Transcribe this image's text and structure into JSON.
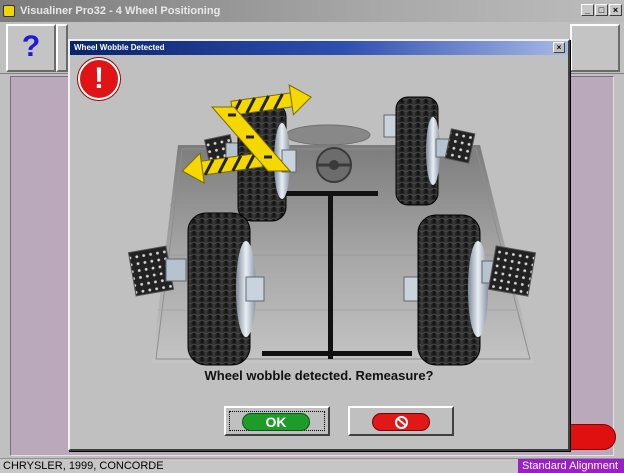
{
  "app": {
    "title": "Visualiner Pro32 - 4 Wheel Positioning",
    "window_controls": [
      "_",
      "□",
      "×"
    ]
  },
  "toolbar": {
    "buttons": [
      {
        "name": "help",
        "icon": "help-question-icon",
        "glyph": "?"
      },
      {
        "name": "tool-2",
        "icon": "vehicle-icon"
      },
      {
        "name": "tool-3",
        "icon": "flag-icon"
      },
      {
        "name": "tool-4",
        "icon": "spec-icon"
      },
      {
        "name": "tool-5",
        "icon": "measure-icon"
      },
      {
        "name": "tool-6",
        "icon": "adjust-icon"
      },
      {
        "name": "tool-7",
        "icon": "wrench-icon"
      },
      {
        "name": "tool-8",
        "icon": "print-icon"
      },
      {
        "name": "tool-9",
        "icon": "report-icon"
      }
    ]
  },
  "dialog": {
    "title": "Wheel Wobble Detected",
    "close_glyph": "×",
    "warning_glyph": "!",
    "message": "Wheel wobble detected. Remeasure?",
    "ok_label": "OK",
    "cancel_icon": "no-entry-icon"
  },
  "statusbar": {
    "vehicle": "CHRYSLER, 1999, CONCORDE",
    "mode": "Standard Alignment"
  },
  "colors": {
    "dialog_title_start": "#08246b",
    "workspace": "#b9a9ba",
    "ok_green": "#1e9c2a",
    "cancel_red": "#e01818",
    "mode_purple": "#9a1fc9",
    "arrow_yellow": "#f5d800"
  }
}
